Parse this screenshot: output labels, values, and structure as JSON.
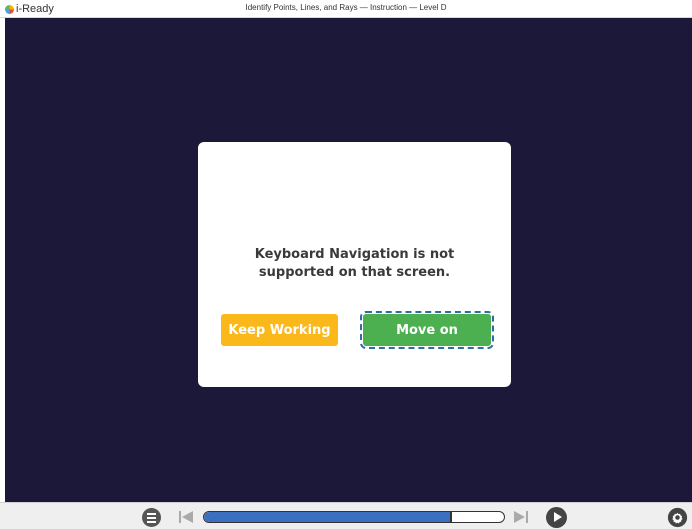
{
  "app": {
    "brand": "i-Ready"
  },
  "header": {
    "title": "Identify Points, Lines, and Rays — Instruction — Level D"
  },
  "dialog": {
    "message": "Keyboard Navigation is not supported on that screen.",
    "keep_working_label": "Keep Working",
    "move_on_label": "Move on"
  },
  "toolbar": {
    "progress": 0.82,
    "icons": [
      "menu-icon",
      "skip-back-icon",
      "skip-forward-icon",
      "play-icon",
      "gear-icon"
    ]
  },
  "colors": {
    "stage_bg": "#1c1839",
    "keep_working": "#fbb81b",
    "move_on": "#4caf50",
    "focus_outline": "#2b6fa8",
    "progress_fill": "#3b6fbf"
  }
}
